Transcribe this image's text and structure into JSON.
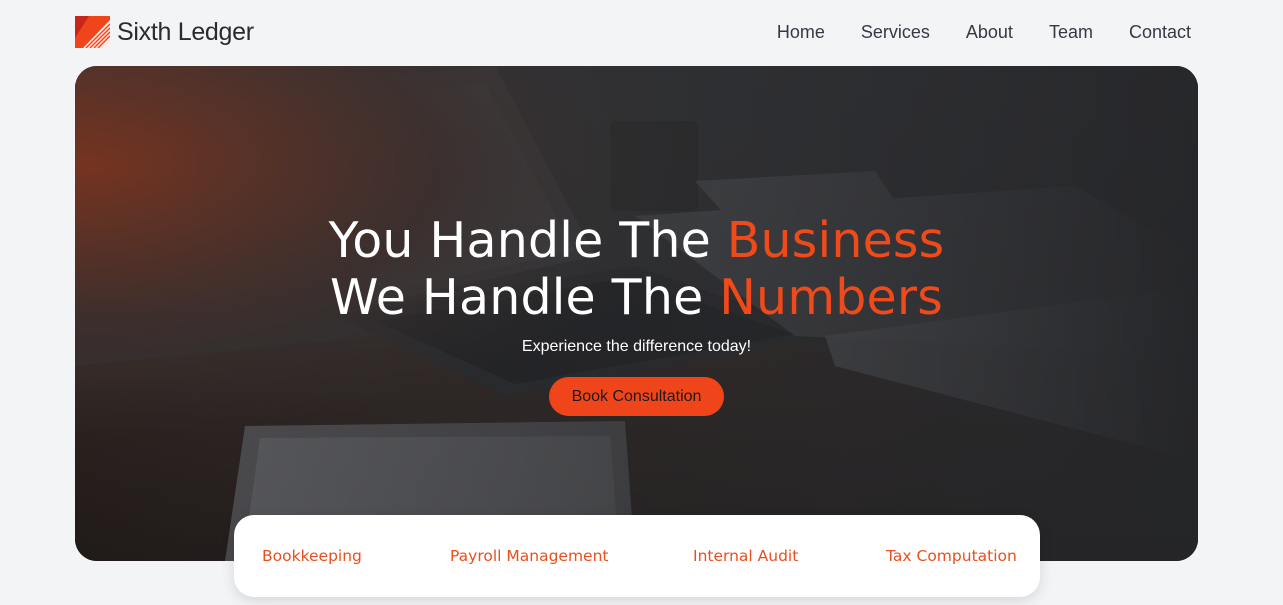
{
  "brand": {
    "name": "Sixth Ledger",
    "accent_color": "#f04a1a"
  },
  "nav": {
    "items": [
      {
        "label": "Home"
      },
      {
        "label": "Services"
      },
      {
        "label": "About"
      },
      {
        "label": "Team"
      },
      {
        "label": "Contact"
      }
    ]
  },
  "hero": {
    "line1_prefix": "You Handle The ",
    "line1_accent": "Business",
    "line2_prefix": "We Handle The ",
    "line2_accent": "Numbers",
    "subtitle": "Experience the difference today!",
    "cta_label": "Book Consultation",
    "background_icon": "office-desk-laptop-photo"
  },
  "services": {
    "items": [
      {
        "label": "Bookkeeping"
      },
      {
        "label": "Payroll Management"
      },
      {
        "label": "Internal Audit"
      },
      {
        "label": "Tax Computation"
      }
    ]
  }
}
